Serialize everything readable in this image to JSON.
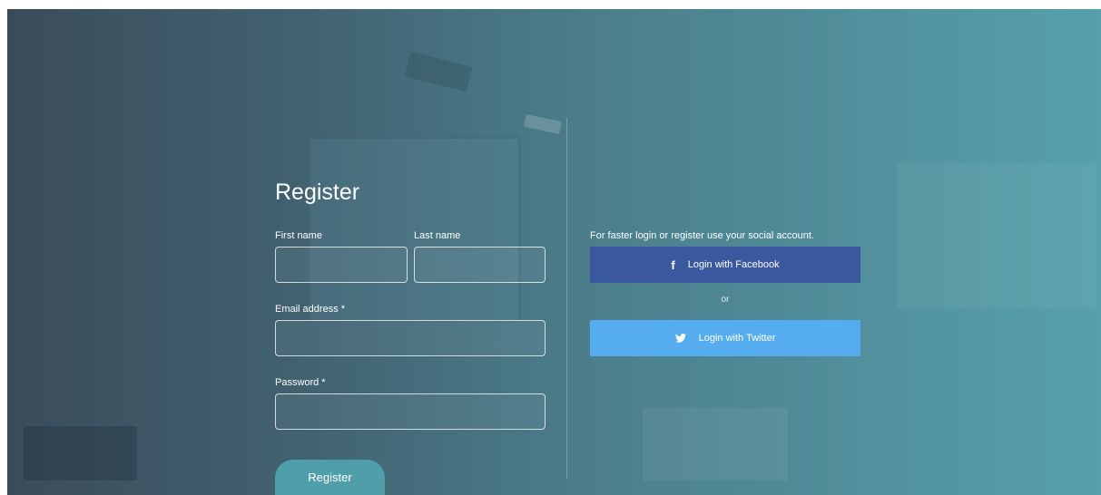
{
  "register": {
    "title": "Register",
    "first_name_label": "First name",
    "last_name_label": "Last name",
    "email_label": "Email address",
    "password_label": "Password",
    "required_mark": "*",
    "first_name_value": "",
    "last_name_value": "",
    "email_value": "",
    "password_value": "",
    "submit_label": "Register"
  },
  "social": {
    "intro": "For faster login or register use your social account.",
    "facebook_label": "Login with Facebook",
    "facebook_icon": "f",
    "separator": "or",
    "twitter_label": "Login with Twitter",
    "twitter_icon": "twitter-bird-icon"
  },
  "colors": {
    "facebook": "#3b579d",
    "twitter": "#55acee",
    "register_button": "#4f9ea9"
  }
}
